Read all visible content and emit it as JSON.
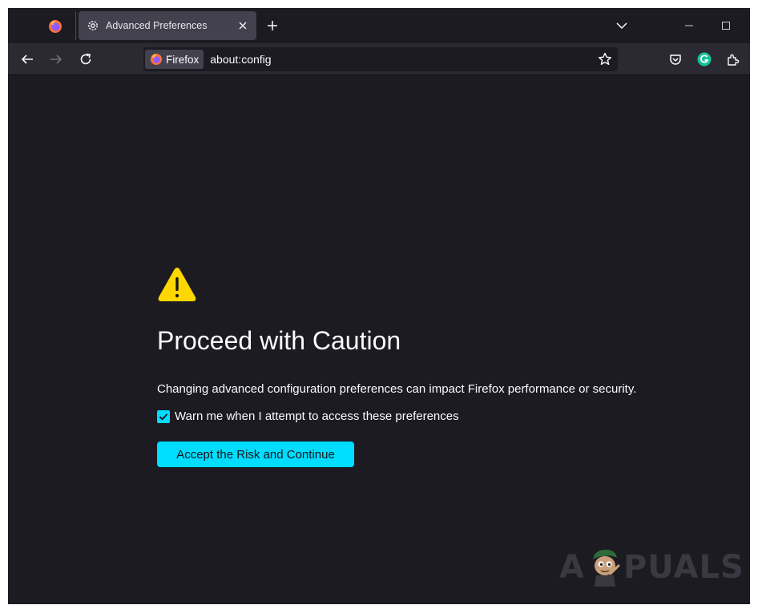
{
  "tab": {
    "title": "Advanced Preferences"
  },
  "urlbar": {
    "identity_label": "Firefox",
    "url": "about:config"
  },
  "page": {
    "title": "Proceed with Caution",
    "description": "Changing advanced configuration preferences can impact Firefox performance or security.",
    "warn_checkbox_label": "Warn me when I attempt to access these preferences",
    "warn_checkbox_checked": true,
    "accept_button_label": "Accept the Risk and Continue"
  },
  "watermark": {
    "text_left": "A",
    "text_right": "PUALS"
  },
  "colors": {
    "accent": "#00ddff",
    "warning": "#ffd700",
    "background": "#1c1b22",
    "toolbar": "#2b2a33",
    "tab_active": "#42414d",
    "text": "#fbfbfe"
  },
  "icons": {
    "firefox_view": "firefox-logo-icon",
    "tab": "gear-icon",
    "close": "close-icon",
    "new_tab": "plus-icon",
    "list_tabs": "chevron-down-icon",
    "minimize": "minimize-icon",
    "maximize": "maximize-icon",
    "back": "arrow-left-icon",
    "forward": "arrow-right-icon",
    "reload": "reload-icon",
    "bookmark": "star-icon",
    "pocket": "pocket-icon",
    "grammarly": "grammarly-icon",
    "extensions": "puzzle-icon",
    "warning": "warning-triangle-icon"
  }
}
